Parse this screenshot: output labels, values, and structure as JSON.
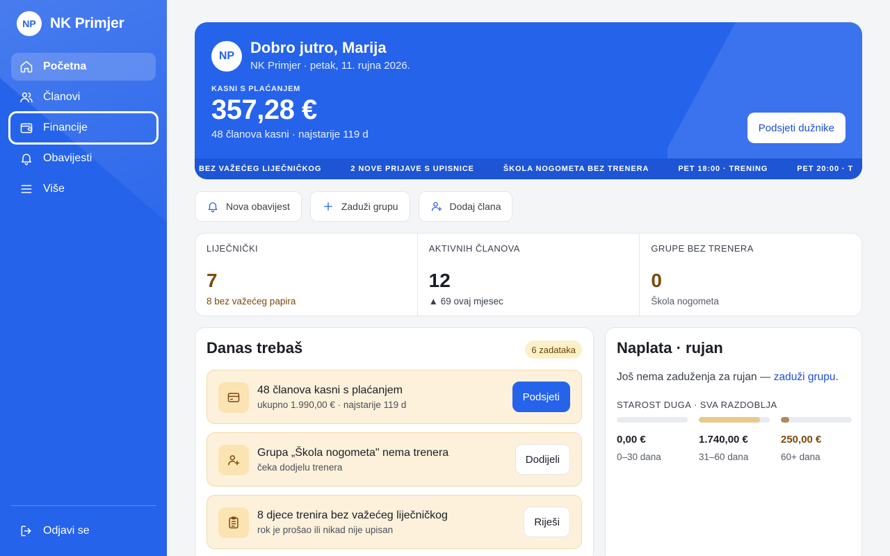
{
  "sidebar": {
    "logo_initials": "NP",
    "club_name": "NK Primjer",
    "items": [
      {
        "label": "Početna",
        "icon": "home-icon"
      },
      {
        "label": "Članovi",
        "icon": "users-icon"
      },
      {
        "label": "Financije",
        "icon": "wallet-icon"
      },
      {
        "label": "Obavijesti",
        "icon": "bell-icon"
      },
      {
        "label": "Više",
        "icon": "menu-icon"
      }
    ],
    "logout_label": "Odjavi se"
  },
  "hero": {
    "avatar_initials": "NP",
    "greeting": "Dobro jutro, Marija",
    "subtitle": "NK Primjer · petak, 11. rujna 2026.",
    "overdue_label": "KASNI S PLAĆANJEM",
    "overdue_amount": "357,28 €",
    "overdue_sub": "48 članova kasni · najstarije 119 d",
    "remind_button": "Podsjeti dužnike",
    "ticker": [
      "BEZ VAŽEĆEG LIJEČNIČKOG",
      "2 NOVE PRIJAVE S UPISNICE",
      "ŠKOLA NOGOMETA BEZ TRENERA",
      "PET 18:00 · TRENING",
      "PET 20:00 · T"
    ]
  },
  "quick_actions": [
    {
      "label": "Nova obavijest",
      "icon": "bell-icon"
    },
    {
      "label": "Zaduži grupu",
      "icon": "plus-icon"
    },
    {
      "label": "Dodaj člana",
      "icon": "user-plus-icon"
    }
  ],
  "stats": [
    {
      "label": "LIJEČNIČKI",
      "value": "7",
      "sub": "8 bez važećeg papira"
    },
    {
      "label": "AKTIVNIH ČLANOVA",
      "value": "12",
      "sub": "▲ 69 ovaj mjesec"
    },
    {
      "label": "GRUPE BEZ TRENERA",
      "value": "0",
      "sub": "Škola nogometa"
    }
  ],
  "tasks": {
    "title": "Danas trebaš",
    "badge": "6 zadataka",
    "items": [
      {
        "title": "48 članova kasni s plaćanjem",
        "sub": "ukupno 1.990,00 € · najstarije 119 d",
        "button": "Podsjeti",
        "icon": "credit-card-icon"
      },
      {
        "title": "Grupa „Škola nogometa\" nema trenera",
        "sub": "čeka dodjelu trenera",
        "button": "Dodijeli",
        "icon": "user-plus-icon"
      },
      {
        "title": "8 djece trenira bez važećeg liječničkog",
        "sub": "rok je prošao ili nikad nije upisan",
        "button": "Riješi",
        "icon": "clipboard-icon"
      }
    ]
  },
  "collection": {
    "title": "Naplata · rujan",
    "empty_text": "Još nema zaduženja za rujan — ",
    "empty_link": "zaduži grupu",
    "empty_end": ".",
    "age_label": "STAROST DUGA · SVA RAZDOBLJA",
    "buckets": [
      {
        "amount": "0,00 €",
        "range": "0–30 dana",
        "fill": 0.0,
        "color": "#e8ebf1"
      },
      {
        "amount": "1.740,00 €",
        "range": "31–60 dana",
        "fill": 0.86,
        "color": "#e9c98a"
      },
      {
        "amount": "250,00 €",
        "range": "60+ dana",
        "fill": 0.12,
        "color": "#b0895a"
      }
    ]
  },
  "colors": {
    "primary": "#2563eb",
    "warning_bg": "#fdf1dc",
    "brown": "#7a4a0c"
  }
}
